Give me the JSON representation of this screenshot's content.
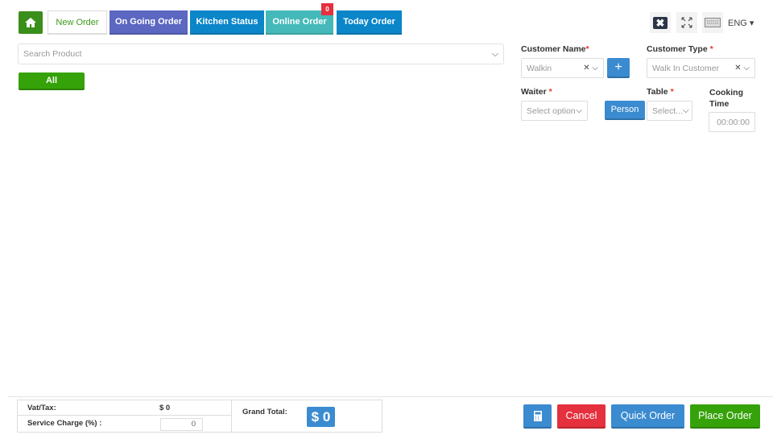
{
  "tabs": {
    "new_order": "New Order",
    "ongoing": "On Going Order",
    "kitchen": "Kitchen Status",
    "online": "Online Order",
    "online_badge": "0",
    "today": "Today Order"
  },
  "topbar": {
    "language": "ENG"
  },
  "search": {
    "placeholder": "Search Product"
  },
  "categories": [
    {
      "label": "All"
    }
  ],
  "form": {
    "customer_name_label": "Customer Name",
    "customer_name_value": "Walkin",
    "customer_type_label": "Customer Type",
    "customer_type_value": "Walk In Customer",
    "waiter_label": "Waiter",
    "waiter_placeholder": "Select option",
    "person_label": "Person",
    "table_label": "Table",
    "table_placeholder": "Select...",
    "cooking_time_label": "Cooking Time",
    "cooking_time_placeholder": "00:00:00",
    "required_mark": "*",
    "add_label": "+"
  },
  "footer": {
    "vat_label": "Vat/Tax:",
    "vat_value": "$ 0",
    "service_label": "Service Charge (%) :",
    "service_value": "0",
    "grand_total_label": "Grand Total:",
    "grand_total_value": "$ 0",
    "cancel": "Cancel",
    "quick_order": "Quick Order",
    "place_order": "Place Order"
  }
}
